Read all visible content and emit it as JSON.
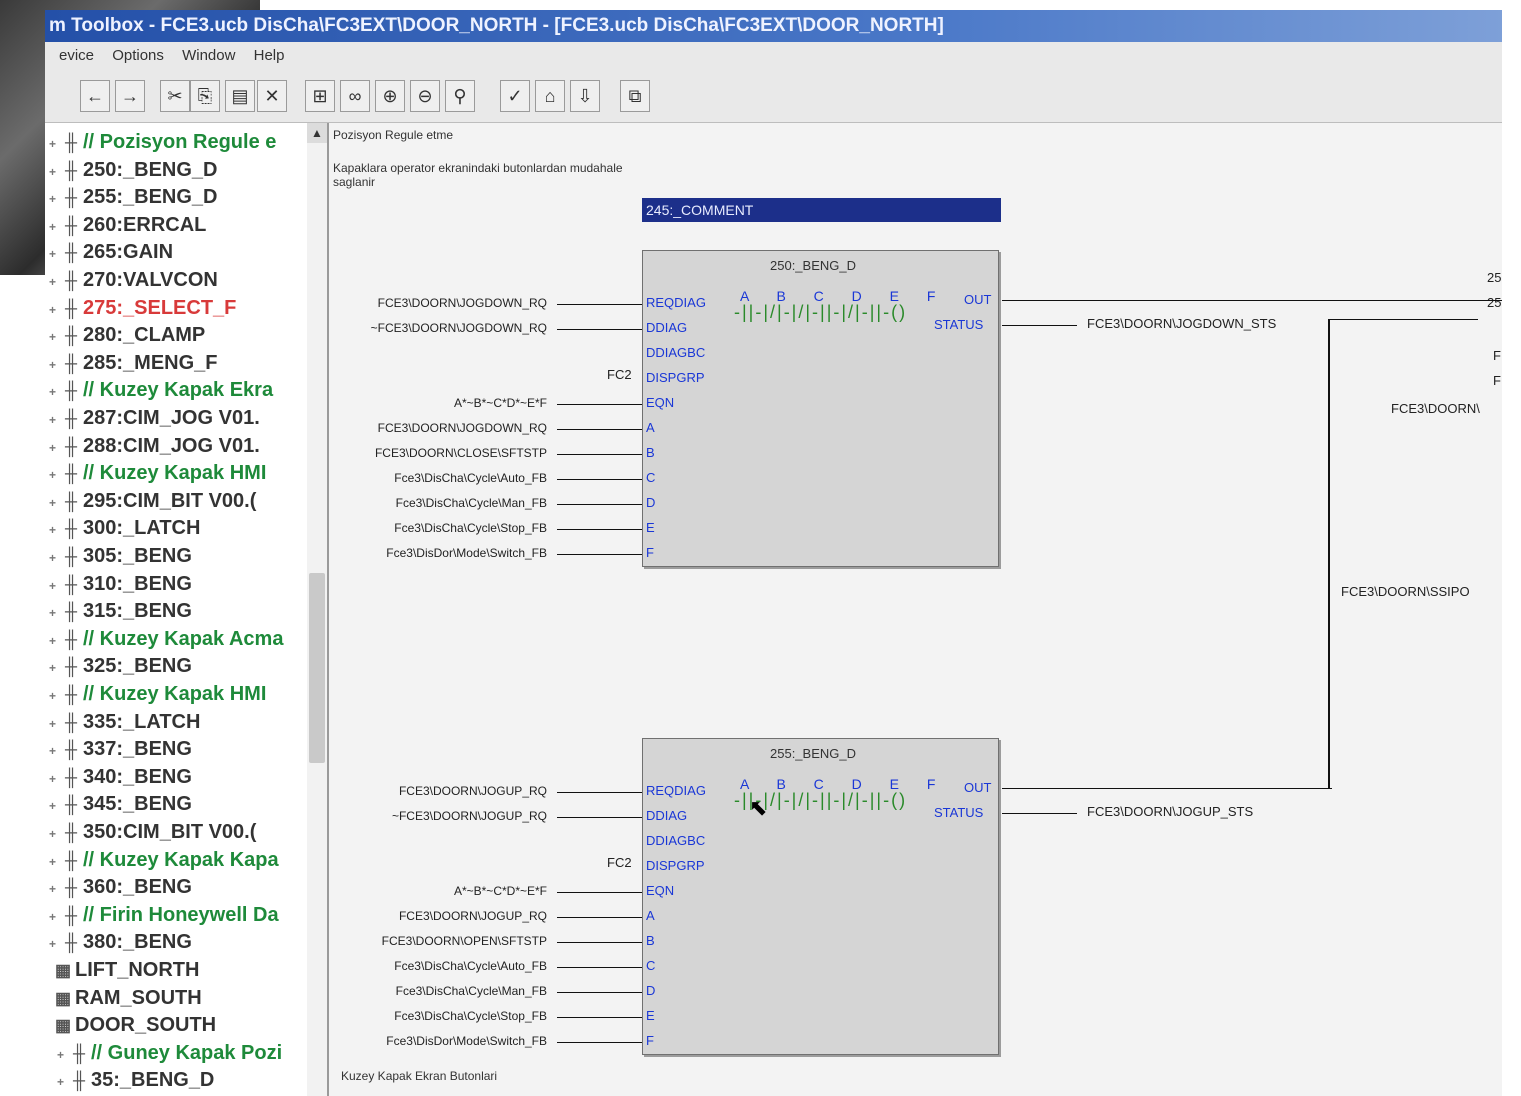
{
  "window": {
    "title": "m Toolbox - FCE3.ucb DisCha\\FC3EXT\\DOOR_NORTH - [FCE3.ucb DisCha\\FC3EXT\\DOOR_NORTH]"
  },
  "menu": [
    "evice",
    "Options",
    "Window",
    "Help"
  ],
  "toolbar": {
    "icons": [
      "back-arrow-icon",
      "forward-arrow-icon",
      "cut-icon",
      "copy-icon",
      "paste-icon",
      "delete-icon",
      "grid-icon",
      "glasses-icon",
      "zoom-in-icon",
      "zoom-out-icon",
      "find-icon",
      "check-icon",
      "build-icon",
      "download-icon",
      "properties-icon"
    ],
    "glyphs": [
      "←",
      "→",
      "✂",
      "⎘",
      "▤",
      "✕",
      "⊞",
      "∞",
      "⊕",
      "⊖",
      "⚲",
      "✓",
      "⌂",
      "⇩",
      "⧉"
    ]
  },
  "tree": {
    "items": [
      {
        "label": "// Pozisyon Regule e",
        "kind": "comment"
      },
      {
        "label": "250:_BENG_D",
        "kind": "block"
      },
      {
        "label": "255:_BENG_D",
        "kind": "block"
      },
      {
        "label": "260:ERRCAL",
        "kind": "block"
      },
      {
        "label": "265:GAIN",
        "kind": "block"
      },
      {
        "label": "270:VALVCON",
        "kind": "block"
      },
      {
        "label": "275:_SELECT_F",
        "kind": "error"
      },
      {
        "label": "280:_CLAMP",
        "kind": "block"
      },
      {
        "label": "285:_MENG_F",
        "kind": "block"
      },
      {
        "label": "// Kuzey Kapak Ekra",
        "kind": "comment"
      },
      {
        "label": "287:CIM_JOG   V01.",
        "kind": "block"
      },
      {
        "label": "288:CIM_JOG   V01.",
        "kind": "block"
      },
      {
        "label": "// Kuzey Kapak HMI",
        "kind": "comment"
      },
      {
        "label": "295:CIM_BIT   V00.(",
        "kind": "block"
      },
      {
        "label": "300:_LATCH",
        "kind": "block"
      },
      {
        "label": "305:_BENG",
        "kind": "block"
      },
      {
        "label": "310:_BENG",
        "kind": "block"
      },
      {
        "label": "315:_BENG",
        "kind": "block"
      },
      {
        "label": "// Kuzey Kapak Acma",
        "kind": "comment"
      },
      {
        "label": "325:_BENG",
        "kind": "block"
      },
      {
        "label": "// Kuzey Kapak HMI",
        "kind": "comment"
      },
      {
        "label": "335:_LATCH",
        "kind": "block"
      },
      {
        "label": "337:_BENG",
        "kind": "block"
      },
      {
        "label": "340:_BENG",
        "kind": "block"
      },
      {
        "label": "345:_BENG",
        "kind": "block"
      },
      {
        "label": "350:CIM_BIT   V00.(",
        "kind": "block"
      },
      {
        "label": "// Kuzey Kapak Kapa",
        "kind": "comment"
      },
      {
        "label": "360:_BENG",
        "kind": "block"
      },
      {
        "label": "// Firin Honeywell Da",
        "kind": "comment"
      },
      {
        "label": "380:_BENG",
        "kind": "block"
      },
      {
        "label": "LIFT_NORTH",
        "kind": "folder"
      },
      {
        "label": "RAM_SOUTH",
        "kind": "folder"
      },
      {
        "label": "DOOR_SOUTH",
        "kind": "folder"
      },
      {
        "label": "// Guney Kapak Pozi",
        "kind": "comment"
      },
      {
        "label": "35:_BENG_D",
        "kind": "block"
      }
    ]
  },
  "canvas": {
    "note_title": "Pozisyon Regule etme",
    "note_line1": "Kapaklara operator ekranindaki butonlardan mudahale",
    "note_line2": "saglanir",
    "comment_block": "245:_COMMENT",
    "footer_note": "Kuzey Kapak Ekran Butonlari",
    "right_labels": [
      "25",
      "25",
      "F",
      "F",
      "FCE3\\DOORN\\",
      "FCE3\\DOORN\\SSIPO"
    ]
  },
  "blocks": [
    {
      "title": "250:_BENG_D",
      "pins": [
        "REQDIAG",
        "DDIAG",
        "DDIAGBC",
        "DISPGRP",
        "EQN",
        "A",
        "B",
        "C",
        "D",
        "E",
        "F"
      ],
      "inputs": [
        "FCE3\\DOORN\\JOGDOWN_RQ",
        "~FCE3\\DOORN\\JOGDOWN_RQ",
        "",
        "FC2",
        "A*~B*~C*D*~E*F",
        "FCE3\\DOORN\\JOGDOWN_RQ",
        "FCE3\\DOORN\\CLOSE\\SFTSTP",
        "Fce3\\DisCha\\Cycle\\Auto_FB",
        "Fce3\\DisCha\\Cycle\\Man_FB",
        "Fce3\\DisCha\\Cycle\\Stop_FB",
        "Fce3\\DisDor\\Mode\\Switch_FB"
      ],
      "out": "OUT",
      "status": "STATUS",
      "status_signal": "FCE3\\DOORN\\JOGDOWN_STS",
      "contacts": "A B C D E F",
      "ladder": "-||-|/|-|/|-||-|/|-||-()",
      "fc2": "FC2"
    },
    {
      "title": "255:_BENG_D",
      "pins": [
        "REQDIAG",
        "DDIAG",
        "DDIAGBC",
        "DISPGRP",
        "EQN",
        "A",
        "B",
        "C",
        "D",
        "E",
        "F"
      ],
      "inputs": [
        "FCE3\\DOORN\\JOGUP_RQ",
        "~FCE3\\DOORN\\JOGUP_RQ",
        "",
        "FC2",
        "A*~B*~C*D*~E*F",
        "FCE3\\DOORN\\JOGUP_RQ",
        "FCE3\\DOORN\\OPEN\\SFTSTP",
        "Fce3\\DisCha\\Cycle\\Auto_FB",
        "Fce3\\DisCha\\Cycle\\Man_FB",
        "Fce3\\DisCha\\Cycle\\Stop_FB",
        "Fce3\\DisDor\\Mode\\Switch_FB"
      ],
      "out": "OUT",
      "status": "STATUS",
      "status_signal": "FCE3\\DOORN\\JOGUP_STS",
      "contacts": "A B C D E F",
      "ladder": "-||-|/|-|/|-||-|/|-||-()",
      "fc2": "FC2"
    }
  ]
}
